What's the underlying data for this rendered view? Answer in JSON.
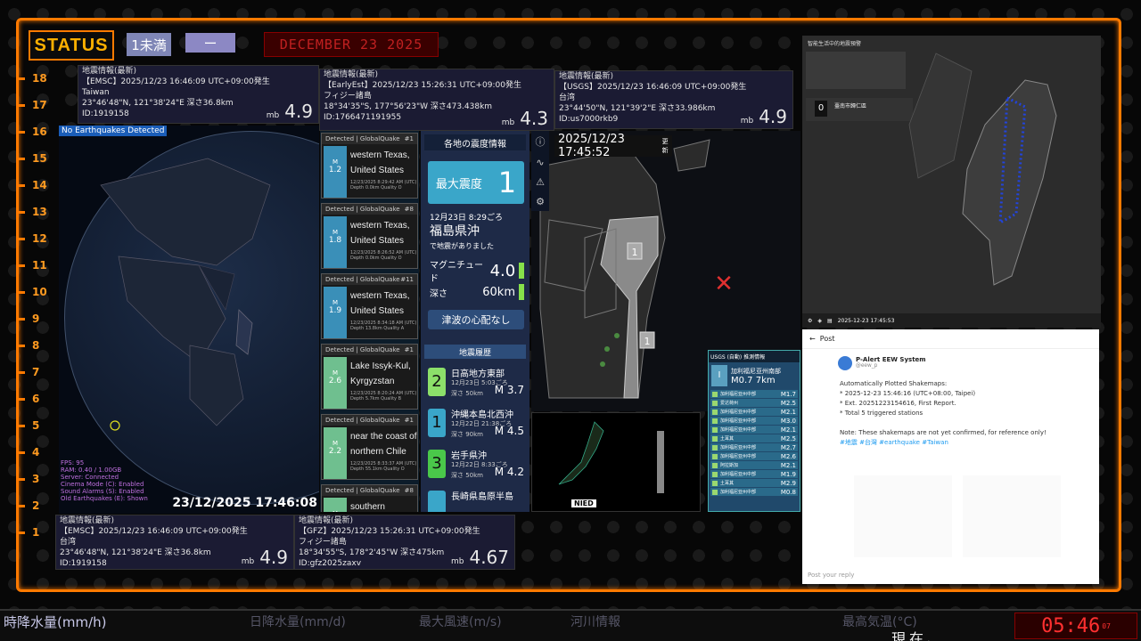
{
  "status": {
    "label": "STATUS",
    "badge1": "1未満",
    "badge2": "ー",
    "date": "DECEMBER 23 2025"
  },
  "ruler": [
    "18",
    "17",
    "16",
    "15",
    "14",
    "13",
    "12",
    "11",
    "10",
    "9",
    "8",
    "7",
    "6",
    "5",
    "4",
    "3",
    "2",
    "1"
  ],
  "panels": [
    {
      "hd": "地震情報(最新)",
      "src": "【EMSC】2025/12/23 16:46:09 UTC+09:00発生",
      "place": "Taiwan",
      "coords": "23°46'48\"N, 121°38'24\"E 深さ36.8km",
      "id": "ID:1919158",
      "mb": "mb",
      "mag": "4.9"
    },
    {
      "hd": "地震情報(最新)",
      "src": "【EarlyEst】2025/12/23 15:26:31 UTC+09:00発生",
      "place": "フィジー諸島",
      "coords": "18°34'35\"S, 177°56'23\"W 深さ473.438km",
      "id": "ID:1766471191955",
      "mb": "mb",
      "mag": "4.3"
    },
    {
      "hd": "地震情報(最新)",
      "src": "【USGS】2025/12/23 16:46:09 UTC+09:00発生",
      "place": "台湾",
      "coords": "23°44'50\"N, 121°39'2\"E 深さ33.986km",
      "id": "ID:us7000rkb9",
      "mb": "mb",
      "mag": "4.9"
    },
    {
      "hd": "地震情報(最新)",
      "src": "【EMSC】2025/12/23 16:46:09 UTC+09:00発生",
      "place": "台湾",
      "coords": "23°46'48\"N, 121°38'24\"E 深さ36.8km",
      "id": "ID:1919158",
      "mb": "mb",
      "mag": "4.9"
    },
    {
      "hd": "地震情報(最新)",
      "src": "【GFZ】2025/12/23 15:26:31 UTC+09:00発生",
      "place": "フィジー諸島",
      "coords": "18°34'55\"S, 178°2'45\"W 深さ475km",
      "id": "ID:gfz2025zaxv",
      "mb": "mb",
      "mag": "4.67"
    }
  ],
  "globe": {
    "tag": "No Earthquakes Detected",
    "stats": [
      "FPS: 95",
      "RAM: 0.40 / 1.00GB",
      "Server: Connected",
      "Cinema Mode (C): Enabled",
      "Sound Alarms (S): Enabled",
      "Old Earthquakes (E): Shown"
    ],
    "time": "23/12/2025 17:46:08"
  },
  "gq_cards": [
    {
      "hd": "Detected | GlobalQuake",
      "n": "#1",
      "m": "1.2",
      "place1": "western Texas,",
      "place2": "United States",
      "date": "12/23/2025 8:29:42 AM (UTC)",
      "meta": "Depth 0.0km   Quality O",
      "color": "#3a8fb8"
    },
    {
      "hd": "Detected | GlobalQuake",
      "n": "#8",
      "m": "1.8",
      "place1": "western Texas,",
      "place2": "United States",
      "date": "12/23/2025 8:26:52 AM (UTC)",
      "meta": "Depth 0.0km   Quality O",
      "color": "#3a8fb8"
    },
    {
      "hd": "Detected | GlobalQuake",
      "n": "#11",
      "m": "1.9",
      "place1": "western Texas,",
      "place2": "United States",
      "date": "12/23/2025 8:34:18 AM (UTC)",
      "meta": "Depth 13.8km   Quality A",
      "color": "#3a8fb8"
    },
    {
      "hd": "Detected | GlobalQuake",
      "n": "#1",
      "m": "2.6",
      "place1": "Lake Issyk-Kul,",
      "place2": "Kyrgyzstan",
      "date": "12/23/2025 8:20:24 AM (UTC)",
      "meta": "Depth 5.7km   Quality B",
      "color": "#6fbf8f"
    },
    {
      "hd": "Detected | GlobalQuake",
      "n": "#1",
      "m": "2.2",
      "place1": "near the coast of",
      "place2": "northern Chile",
      "date": "12/23/2025 8:33:37 AM (UTC)",
      "meta": "Depth 55.1km   Quality O",
      "color": "#6fbf8f"
    },
    {
      "hd": "Detected | GlobalQuake",
      "n": "#8",
      "m": "",
      "place1": "southern California,",
      "place2": "",
      "date": "",
      "meta": "",
      "color": "#6fbf8f"
    }
  ],
  "jma": {
    "header": "各地の震度情報",
    "max_label": "最大震度",
    "max_val": "1",
    "time": "12月23日 8:29ごろ",
    "place": "福島県沖",
    "note": "で地震がありました",
    "mag_label": "マグニチュード",
    "mag": "4.0",
    "depth_label": "深さ",
    "depth": "60km",
    "tsunami": "津波の心配なし",
    "hist_header": "地震履歴",
    "history": [
      {
        "s": "2",
        "title": "日高地方東部",
        "date": "12月23日 5:03ごろ",
        "depth": "深さ 50km",
        "m": "M 3.7",
        "color": "#8ce06a"
      },
      {
        "s": "1",
        "title": "沖縄本島北西沖",
        "date": "12月22日 21:38ごろ",
        "depth": "深さ 90km",
        "m": "M 4.5",
        "color": "#3aa6c9"
      },
      {
        "s": "3",
        "title": "岩手県沖",
        "date": "12月22日 8:33ごろ",
        "depth": "深さ 50km",
        "m": "M 4.2",
        "color": "#4ac84a"
      },
      {
        "s": "",
        "title": "長崎県島原半島",
        "date": "",
        "depth": "",
        "m": "",
        "color": "#3aa6c9"
      }
    ]
  },
  "map": {
    "time": "2025/12/23 17:45:52",
    "suffix": "更新",
    "marker": "✕",
    "s1": "1",
    "s2": "1"
  },
  "nied": {
    "logo": "NIED"
  },
  "usgs": {
    "header": "USGS (自動) 推測情報",
    "place": "加利福尼亚州南部",
    "mag": "M0.7",
    "depth": "7km",
    "rows": [
      {
        "p": "加利福尼亚州中部",
        "v": "M1.7"
      },
      {
        "p": "爱达荷州",
        "v": "M2.5"
      },
      {
        "p": "加利福尼亚州中部",
        "v": "M2.1"
      },
      {
        "p": "加利福尼亚州中部",
        "v": "M3.0"
      },
      {
        "p": "加利福尼亚州中部",
        "v": "M2.1"
      },
      {
        "p": "土耳其",
        "v": "M2.5"
      },
      {
        "p": "加利福尼亚州中部",
        "v": "M2.7"
      },
      {
        "p": "加利福尼亚州中部",
        "v": "M2.6"
      },
      {
        "p": "阿拉斯加",
        "v": "M2.1"
      },
      {
        "p": "加利福尼亚州中部",
        "v": "M1.9"
      },
      {
        "p": "土耳其",
        "v": "M2.9"
      },
      {
        "p": "加利福尼亚州中部",
        "v": "M0.8"
      }
    ]
  },
  "taiwan": {
    "title": "智能生活中的地震預警",
    "zero": "0",
    "info": "臺南市歸仁區",
    "bottom": "2025-12-23 17:45:53"
  },
  "post": {
    "header": "Post",
    "user": "P-Alert EEW System",
    "handle": "@eew_p",
    "body": "Automatically Plotted Shakemaps:\n* 2025-12-23 15:46:16 (UTC+08:00, Taipei)\n* Ext. 20251223154616, First Report.\n* Total 5 triggered stations\n\nNote: These shakemaps are not yet confirmed, for reference only!",
    "tags": "#地震 #台灣 #earthquake #Taiwan",
    "reply": "Post your reply"
  },
  "ticker": {
    "t1": "時降水量(mm/h)",
    "t2": "日降水量(mm/d)",
    "t3": "最大風速(m/s)",
    "t4": "河川情報",
    "t5": "最高気温(°C)",
    "t6": "現在、"
  },
  "clock": {
    "time": "05:46",
    "sec": "07"
  }
}
